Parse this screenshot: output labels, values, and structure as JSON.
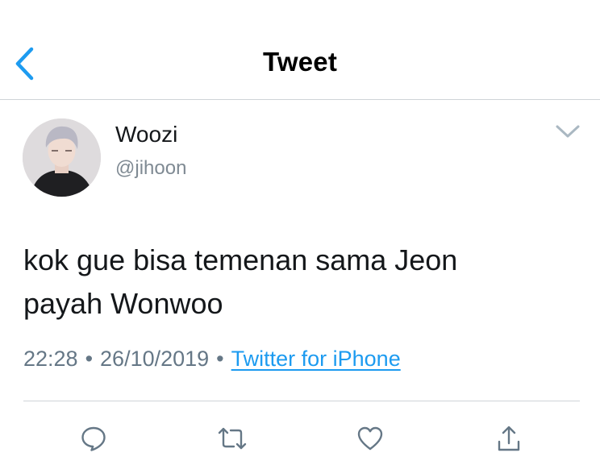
{
  "header": {
    "title": "Tweet",
    "back_icon": "chevron-left-icon",
    "accent_color": "#1d9bf0"
  },
  "tweet": {
    "author": {
      "display_name": "Woozi",
      "handle": "@jihoon",
      "avatar_icon": "profile-photo"
    },
    "text_lines": [
      "kok gue bisa temenan sama Jeon",
      "payah Wonwoo"
    ],
    "time": "22:28",
    "date": "26/10/2019",
    "separator": "•",
    "source": "Twitter for iPhone",
    "menu_icon": "chevron-down-icon"
  },
  "actions": [
    {
      "name": "reply",
      "icon": "reply-icon"
    },
    {
      "name": "retweet",
      "icon": "retweet-icon"
    },
    {
      "name": "like",
      "icon": "heart-icon"
    },
    {
      "name": "share",
      "icon": "share-icon"
    }
  ],
  "colors": {
    "text": "#14171a",
    "secondary_text": "#657786",
    "icon": "#657786",
    "link": "#1d9bf0",
    "divider": "#cfd4d8"
  }
}
